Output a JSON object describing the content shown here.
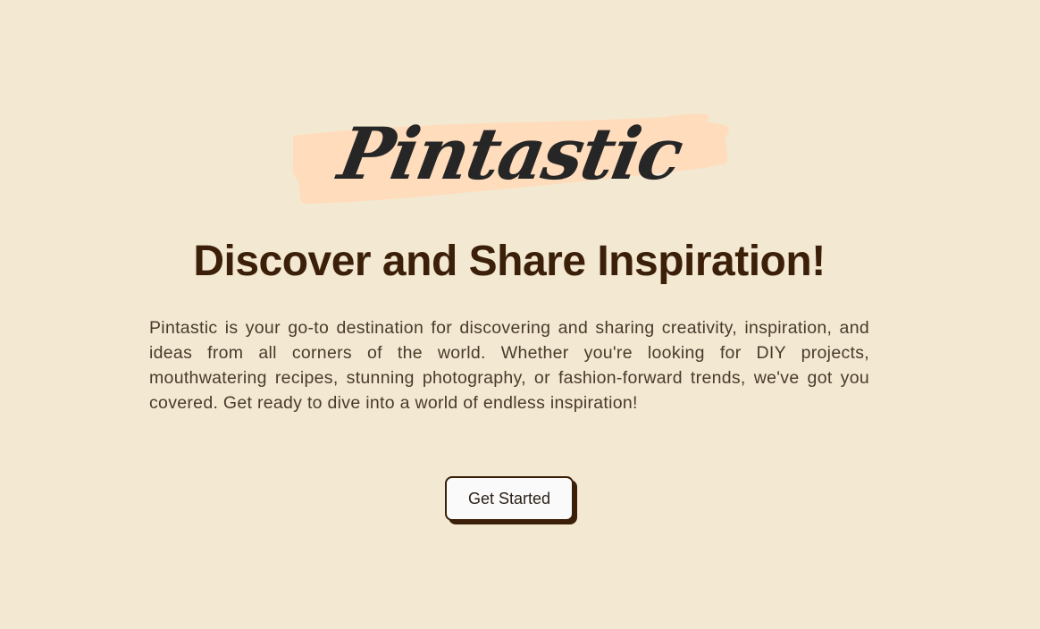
{
  "brand": {
    "logo_text": "Pintastic"
  },
  "hero": {
    "headline": "Discover and Share Inspiration!",
    "description": "Pintastic is your go-to destination for discovering and sharing creativity, inspiration, and ideas from all corners of the world. Whether you're looking for DIY projects, mouthwatering recipes, stunning photography, or fashion-forward trends, we've got you covered. Get ready to dive into a world of endless inspiration!",
    "cta_label": "Get Started"
  },
  "colors": {
    "background": "#f3e9d2",
    "brush_stroke": "#ffdcbc",
    "heading": "#3b1f09",
    "body_text": "#4a3a2c",
    "button_bg": "#fafafa",
    "button_shadow": "#3b1f09"
  }
}
